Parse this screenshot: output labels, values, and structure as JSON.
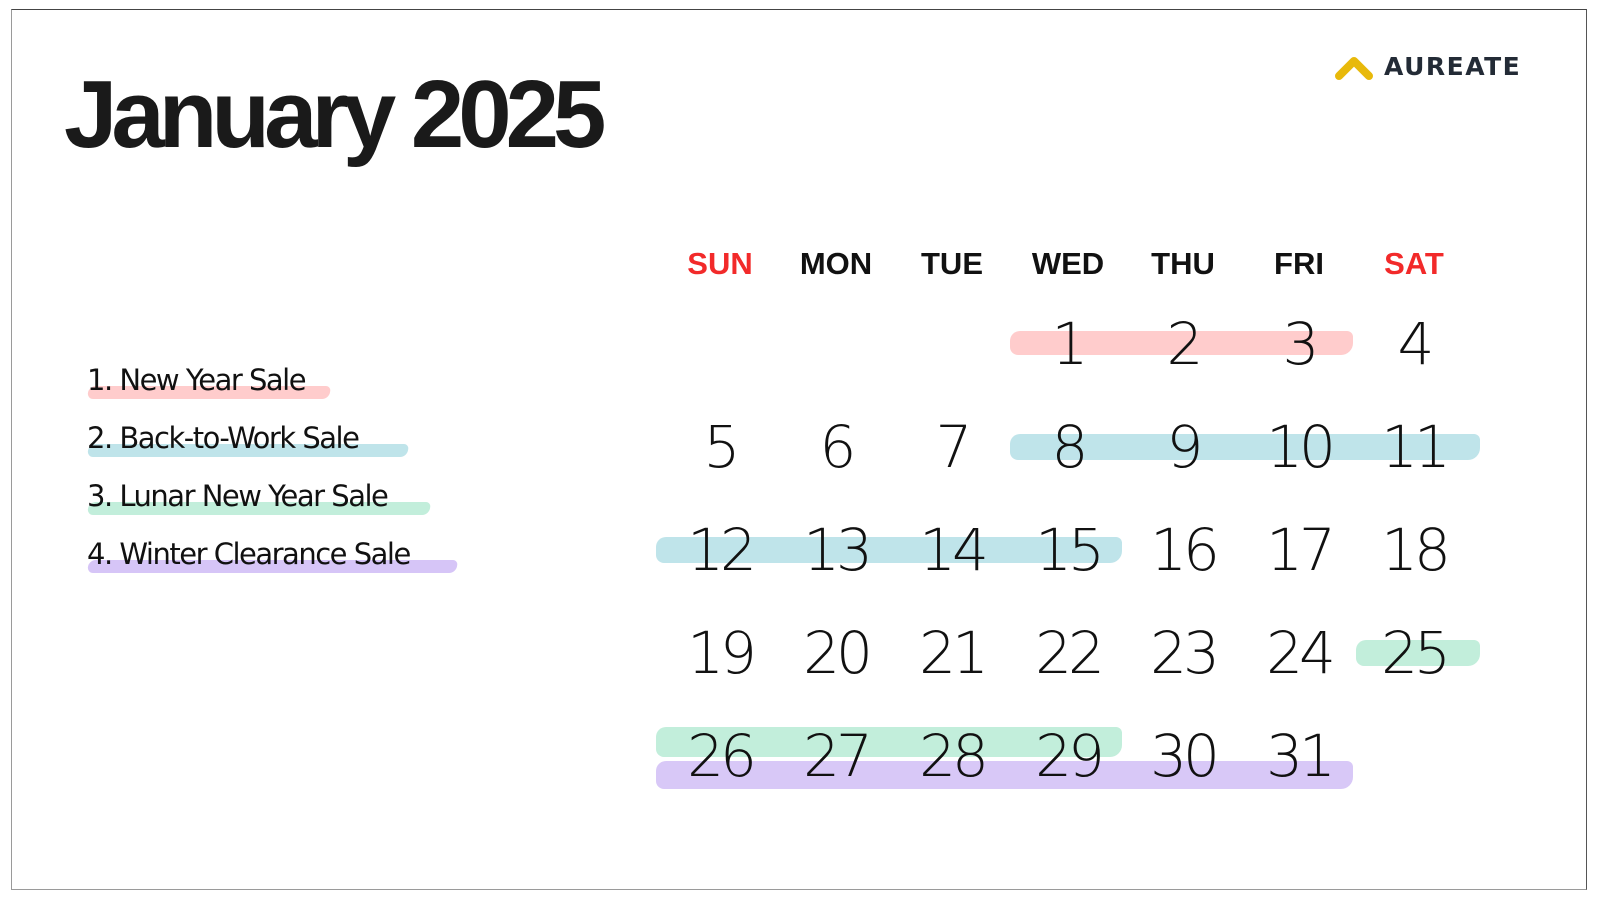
{
  "title": "January 2025",
  "brand": {
    "name": "AUREATE",
    "icon": "chevron-up-icon",
    "icon_color": "#e8b90a"
  },
  "colors": {
    "weekend_label": "#f22a2a",
    "new_year_sale": "#ffcccc",
    "back_to_work_sale": "#bfe4ea",
    "lunar_new_year_sale": "#c2eedb",
    "winter_clearance_sale": "#d6c5f7"
  },
  "legend": [
    {
      "label": "1. New Year Sale",
      "color": "#ffcccc"
    },
    {
      "label": "2. Back-to-Work Sale",
      "color": "#bfe4ea"
    },
    {
      "label": "3. Lunar New Year Sale",
      "color": "#c2eedb"
    },
    {
      "label": "4. Winter Clearance Sale",
      "color": "#d6c5f7"
    }
  ],
  "calendar": {
    "weekdays": [
      "SUN",
      "MON",
      "TUE",
      "WED",
      "THU",
      "FRI",
      "SAT"
    ],
    "first_weekday_index": 3,
    "days_in_month": 31,
    "events": [
      {
        "name": "New Year Sale",
        "start": 1,
        "end": 3,
        "color": "#ffcccc"
      },
      {
        "name": "Back-to-Work Sale",
        "start": 8,
        "end": 15,
        "color": "#bfe4ea"
      },
      {
        "name": "Lunar New Year Sale",
        "start": 25,
        "end": 29,
        "color": "#c2eedb"
      },
      {
        "name": "Winter Clearance Sale",
        "start": 26,
        "end": 31,
        "color": "#d6c5f7"
      }
    ]
  }
}
